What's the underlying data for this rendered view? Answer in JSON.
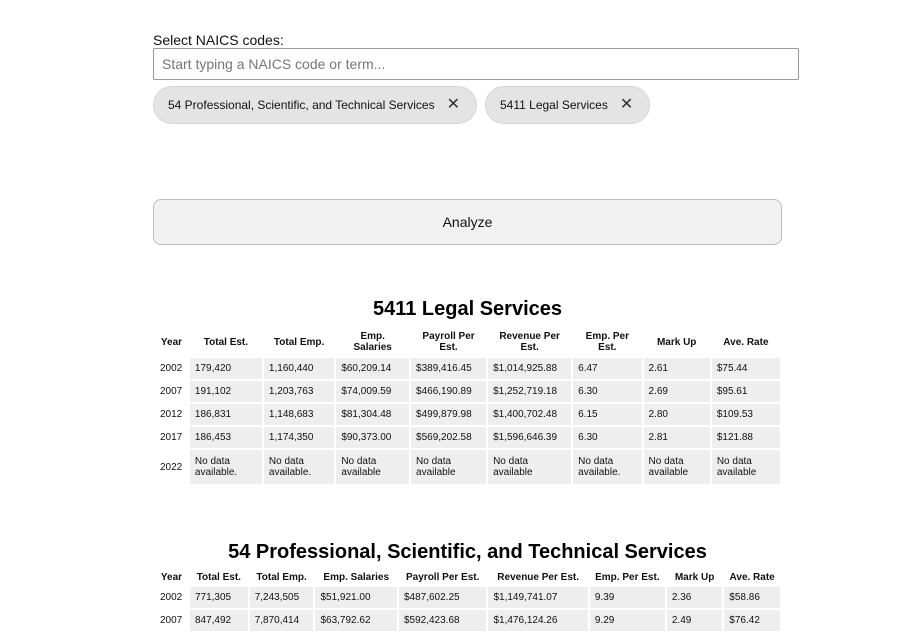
{
  "search": {
    "label": "Select NAICS codes:",
    "placeholder": "Start typing a NAICS code or term..."
  },
  "chips": [
    {
      "label": "54 Professional, Scientific, and Technical Services",
      "remove_glyph": "✕"
    },
    {
      "label": "5411 Legal Services",
      "remove_glyph": "✕"
    }
  ],
  "analyze_label": "Analyze",
  "table1": {
    "title": "5411 Legal Services",
    "headers": [
      "Year",
      "Total Est.",
      "Total Emp.",
      "Emp. Salaries",
      "Payroll Per Est.",
      "Revenue Per Est.",
      "Emp. Per Est.",
      "Mark Up",
      "Ave. Rate"
    ],
    "rows": [
      [
        "2002",
        "179,420",
        "1,160,440",
        "$60,209.14",
        "$389,416.45",
        "$1,014,925.88",
        "6.47",
        "2.61",
        "$75.44"
      ],
      [
        "2007",
        "191,102",
        "1,203,763",
        "$74,009.59",
        "$466,190.89",
        "$1,252,719.18",
        "6.30",
        "2.69",
        "$95.61"
      ],
      [
        "2012",
        "186,831",
        "1,148,683",
        "$81,304.48",
        "$499,879.98",
        "$1,400,702.48",
        "6.15",
        "2.80",
        "$109.53"
      ],
      [
        "2017",
        "186,453",
        "1,174,350",
        "$90,373.00",
        "$569,202.58",
        "$1,596,646.39",
        "6.30",
        "2.81",
        "$121.88"
      ],
      [
        "2022",
        "No data available.",
        "No data available.",
        "No data available",
        "No data available",
        "No data available",
        "No data available.",
        "No data available",
        "No data available"
      ]
    ]
  },
  "table2": {
    "title": "54 Professional, Scientific, and Technical Services",
    "headers": [
      "Year",
      "Total Est.",
      "Total Emp.",
      "Emp. Salaries",
      "Payroll Per Est.",
      "Revenue Per Est.",
      "Emp. Per Est.",
      "Mark Up",
      "Ave. Rate"
    ],
    "rows": [
      [
        "2002",
        "771,305",
        "7,243,505",
        "$51,921.00",
        "$487,602.25",
        "$1,149,741.07",
        "9.39",
        "2.36",
        "$58.86"
      ],
      [
        "2007",
        "847,492",
        "7,870,414",
        "$63,792.62",
        "$592,423.68",
        "$1,476,124.26",
        "9.29",
        "2.49",
        "$76.42"
      ]
    ]
  }
}
